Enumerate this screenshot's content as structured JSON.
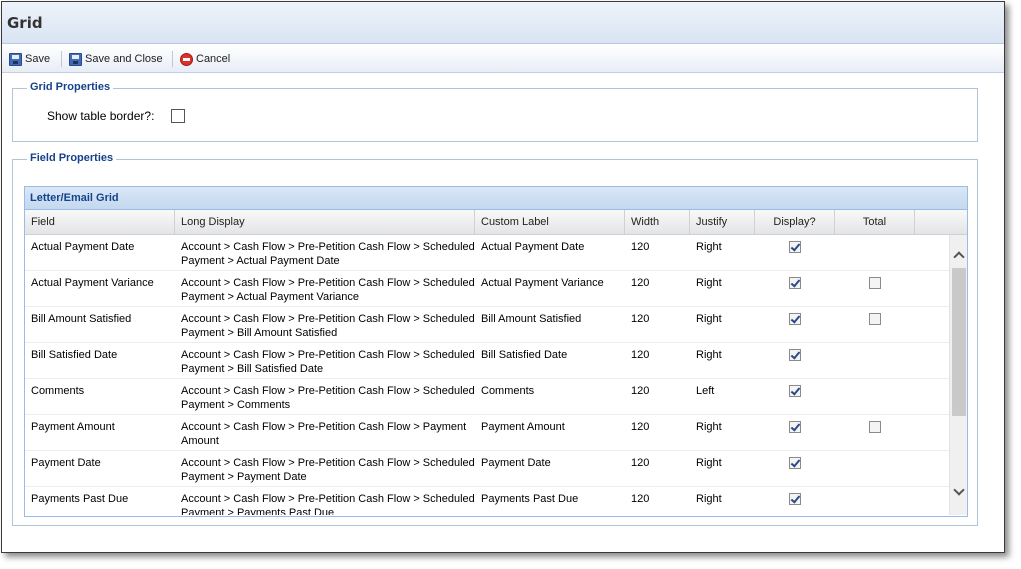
{
  "window": {
    "title": "Grid"
  },
  "toolbar": {
    "save_label": "Save",
    "save_close_label": "Save and Close",
    "cancel_label": "Cancel"
  },
  "grid_properties": {
    "legend": "Grid Properties",
    "show_border_label": "Show table border?:",
    "show_border_checked": false
  },
  "field_properties": {
    "legend": "Field Properties",
    "grid_title": "Letter/Email Grid",
    "columns": [
      "Field",
      "Long Display",
      "Custom Label",
      "Width",
      "Justify",
      "Display?",
      "Total"
    ],
    "rows": [
      {
        "field": "Actual Payment Date",
        "long_display": "Account > Cash Flow > Pre-Petition Cash Flow > Scheduled Payment > Actual Payment Date",
        "custom_label": "Actual Payment Date",
        "width": "120",
        "justify": "Right",
        "display": true,
        "total": null
      },
      {
        "field": "Actual Payment Variance",
        "long_display": "Account > Cash Flow > Pre-Petition Cash Flow > Scheduled Payment > Actual Payment Variance",
        "custom_label": "Actual Payment Variance",
        "width": "120",
        "justify": "Right",
        "display": true,
        "total": false
      },
      {
        "field": "Bill Amount Satisfied",
        "long_display": "Account > Cash Flow > Pre-Petition Cash Flow > Scheduled Payment > Bill Amount Satisfied",
        "custom_label": "Bill Amount Satisfied",
        "width": "120",
        "justify": "Right",
        "display": true,
        "total": false
      },
      {
        "field": "Bill Satisfied Date",
        "long_display": "Account > Cash Flow > Pre-Petition Cash Flow > Scheduled Payment > Bill Satisfied Date",
        "custom_label": "Bill Satisfied Date",
        "width": "120",
        "justify": "Right",
        "display": true,
        "total": null
      },
      {
        "field": "Comments",
        "long_display": "Account > Cash Flow > Pre-Petition Cash Flow > Scheduled Payment > Comments",
        "custom_label": "Comments",
        "width": "120",
        "justify": "Left",
        "display": true,
        "total": null
      },
      {
        "field": "Payment Amount",
        "long_display": "Account > Cash Flow > Pre-Petition Cash Flow > Payment Amount",
        "custom_label": "Payment Amount",
        "width": "120",
        "justify": "Right",
        "display": true,
        "total": false
      },
      {
        "field": "Payment Date",
        "long_display": "Account > Cash Flow > Pre-Petition Cash Flow > Scheduled Payment > Payment Date",
        "custom_label": "Payment Date",
        "width": "120",
        "justify": "Right",
        "display": true,
        "total": null
      },
      {
        "field": "Payments Past Due",
        "long_display": "Account > Cash Flow > Pre-Petition Cash Flow > Scheduled Payment > Payments Past Due",
        "custom_label": "Payments Past Due",
        "width": "120",
        "justify": "Right",
        "display": true,
        "total": null
      }
    ]
  }
}
